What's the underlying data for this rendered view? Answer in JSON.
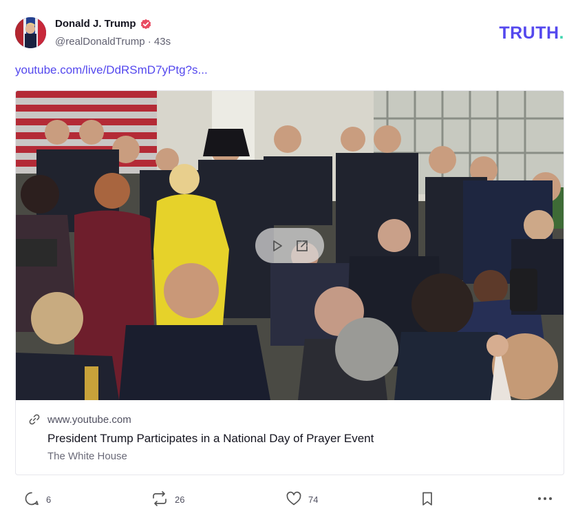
{
  "author": {
    "display_name": "Donald J. Trump",
    "handle": "@realDonaldTrump",
    "separator": "·",
    "timestamp": "43s",
    "avatar_icon": "avatar-flag-photo",
    "verified_icon": "verified-badge-icon",
    "verified_color": "#e94b62"
  },
  "brand": {
    "text": "TRUTH",
    "dot": ".",
    "color": "#5448ee",
    "dot_color": "#40d6b0"
  },
  "post": {
    "link_text": "youtube.com/live/DdRSmD7yPtg?s..."
  },
  "link_card": {
    "domain": "www.youtube.com",
    "title": "President Trump Participates in a National Day of Prayer Event",
    "source": "The White House",
    "media_controls": {
      "play_icon": "play-icon",
      "open_icon": "external-link-icon"
    }
  },
  "actions": {
    "reply": {
      "icon": "reply-icon",
      "count": "6"
    },
    "retruth": {
      "icon": "retruth-icon",
      "count": "26"
    },
    "like": {
      "icon": "heart-icon",
      "count": "74"
    },
    "bookmark": {
      "icon": "bookmark-icon"
    },
    "more": {
      "icon": "more-icon"
    }
  }
}
